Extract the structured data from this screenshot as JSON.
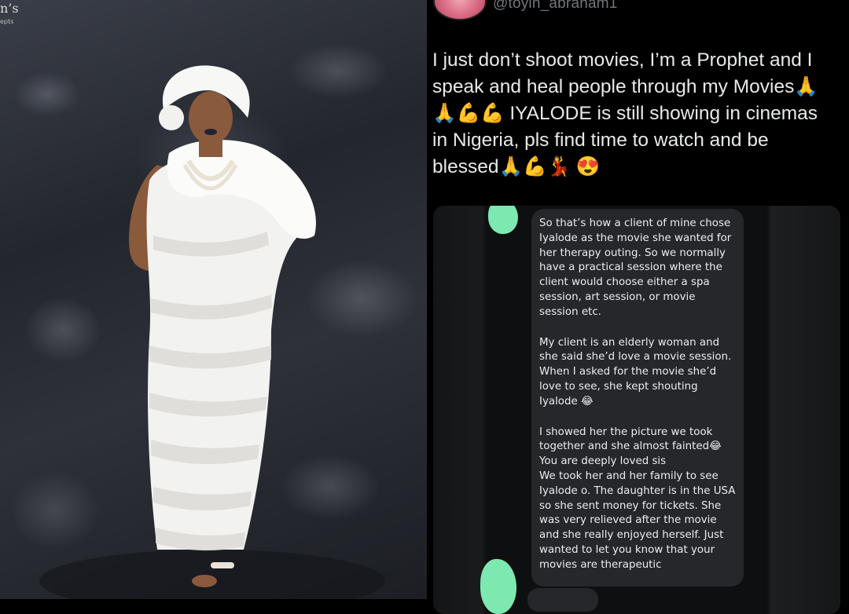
{
  "tweet": {
    "handle": "@toyin_abraham1",
    "text": "I just don’t shoot movies, I’m a Prophet and I speak and heal people through my Movies🙏 🙏💪💪 IYALODE is still showing in cinemas in Nigeria, pls find time to watch and be blessed🙏💪💃 😍"
  },
  "chat": {
    "paragraph_1": "So that’s how a client of mine chose Iyalode as the movie she wanted for her therapy outing. So we normally have a practical session where the client would choose either a spa session, art session, or movie session etc.",
    "paragraph_2": "My client is an elderly woman and she said she’d love a movie session. When I asked for the movie she’d love to see, she kept shouting Iyalode 😂",
    "paragraph_3a": "I showed her the picture we took together and she almost fainted😂",
    "paragraph_3b": "You are deeply loved sis",
    "paragraph_3c": "We took her and her family to see Iyalode o. The daughter is in the USA so she sent money for tickets. She was very relieved after the movie and she really enjoyed herself. Just wanted to let you know that your movies are therapeutic"
  },
  "colors": {
    "background": "#000000",
    "tweet_text": "#e7e9ea",
    "handle": "#71767b",
    "chat_bubble": "#26272b",
    "redaction_blob": "#7de8b0"
  },
  "icons": {
    "photographer_mark": "photographer-watermark-icon"
  }
}
